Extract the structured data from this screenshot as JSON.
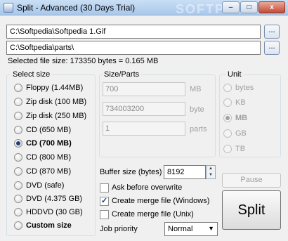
{
  "window": {
    "title": "Split - Advanced (30 Days Trial)",
    "watermark": "SOFTPEDIA",
    "controls": {
      "minimize": "–",
      "maximize": "□",
      "close": "x"
    }
  },
  "source": {
    "path": "C:\\Softpedia\\Softpedia 1.Gif",
    "browse_label": "..."
  },
  "destination": {
    "path": "C:\\Softpedia\\parts\\",
    "browse_label": "..."
  },
  "selected_file_size": "Selected file size: 173350 bytes = 0.165 MB",
  "select_size": {
    "label": "Select size",
    "options": [
      {
        "label": "Floppy (1.44MB)",
        "checked": false
      },
      {
        "label": "Zip disk (100 MB)",
        "checked": false
      },
      {
        "label": "Zip disk (250 MB)",
        "checked": false
      },
      {
        "label": "CD (650 MB)",
        "checked": false
      },
      {
        "label": "CD (700 MB)",
        "checked": true
      },
      {
        "label": "CD (800 MB)",
        "checked": false
      },
      {
        "label": "CD (870 MB)",
        "checked": false
      },
      {
        "label": "DVD (safe)",
        "checked": false
      },
      {
        "label": "DVD (4.375 GB)",
        "checked": false
      },
      {
        "label": "HDDVD (30 GB)",
        "checked": false
      },
      {
        "label": "Custom size",
        "checked": false
      }
    ]
  },
  "size_parts": {
    "label": "Size/Parts",
    "mb_value": "700",
    "mb_unit": "MB",
    "byte_value": "734003200",
    "byte_unit": "byte",
    "parts_value": "1",
    "parts_unit": "parts"
  },
  "unit": {
    "label": "Unit",
    "options": [
      {
        "label": "bytes",
        "checked": false
      },
      {
        "label": "KB",
        "checked": false
      },
      {
        "label": "MB",
        "checked": true
      },
      {
        "label": "GB",
        "checked": false
      },
      {
        "label": "TB",
        "checked": false
      }
    ]
  },
  "buffer": {
    "label": "Buffer size (bytes)",
    "value": "8192"
  },
  "options": {
    "ask_overwrite": {
      "label": "Ask before overwrite",
      "checked": false
    },
    "merge_windows": {
      "label": "Create merge file (Windows)",
      "checked": true
    },
    "merge_unix": {
      "label": "Create merge file (Unix)",
      "checked": false
    }
  },
  "job_priority": {
    "label": "Job priority",
    "value": "Normal"
  },
  "buttons": {
    "pause": "Pause",
    "split": "Split"
  },
  "colors": {
    "title_bar": "#b9d1ee",
    "radio_dot": "#1b3f7a",
    "disabled_text": "#a0a0a0"
  }
}
